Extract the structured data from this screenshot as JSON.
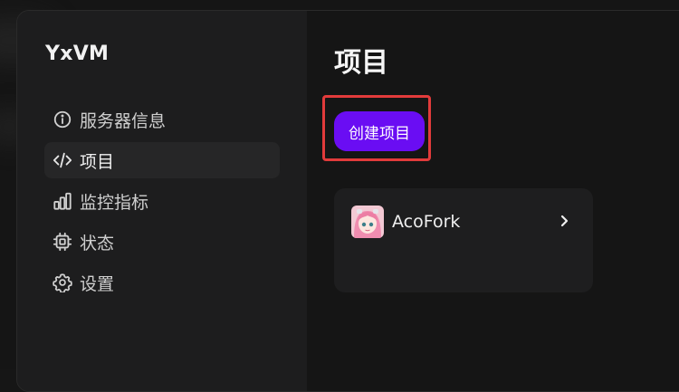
{
  "app": {
    "title": "YxVM"
  },
  "sidebar": {
    "items": [
      {
        "label": "服务器信息",
        "icon": "info-icon",
        "active": false
      },
      {
        "label": "项目",
        "icon": "code-icon",
        "active": true
      },
      {
        "label": "监控指标",
        "icon": "bar-chart-icon",
        "active": false
      },
      {
        "label": "状态",
        "icon": "cpu-icon",
        "active": false
      },
      {
        "label": "设置",
        "icon": "gear-icon",
        "active": false
      }
    ]
  },
  "main": {
    "title": "项目",
    "create_button": "创建项目",
    "projects": [
      {
        "name": "AcoFork",
        "avatar": "anime-avatar"
      }
    ]
  },
  "colors": {
    "accent": "#6a0df3",
    "highlight": "#e23b3b",
    "background": "#151515"
  }
}
